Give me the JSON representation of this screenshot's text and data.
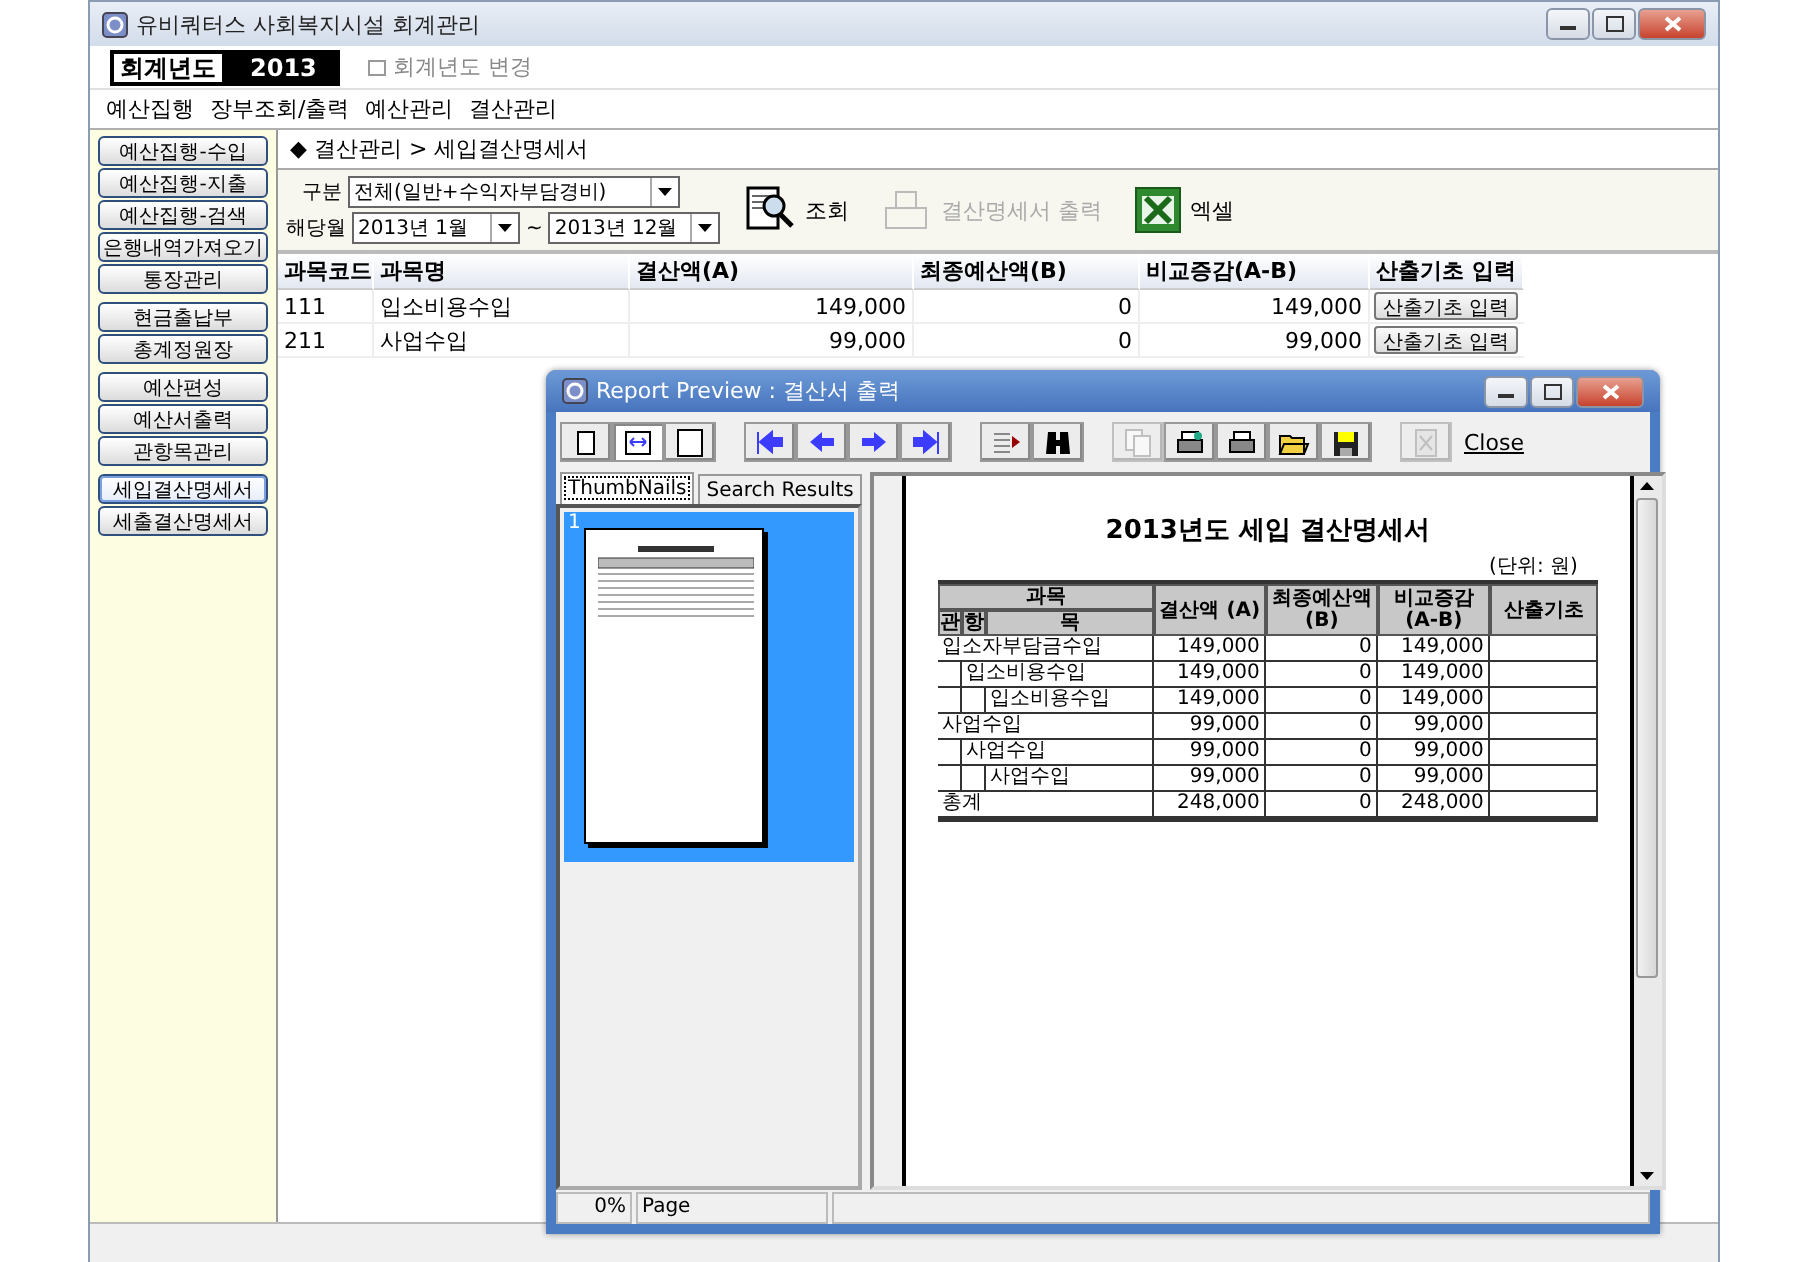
{
  "window": {
    "title": "유비쿼터스 사회복지시설 회계관리"
  },
  "year_bar": {
    "label": "회계년도",
    "year": "2013",
    "change_link": "회계년도 변경"
  },
  "menu": [
    "예산집행",
    "장부조회/출력",
    "예산관리",
    "결산관리"
  ],
  "sidebar": {
    "groups": [
      [
        {
          "label": "예산집행-수입",
          "selected": false
        },
        {
          "label": "예산집행-지출",
          "selected": false
        },
        {
          "label": "예산집행-검색",
          "selected": false
        },
        {
          "label": "은행내역가져오기",
          "selected": false
        },
        {
          "label": "통장관리",
          "selected": false
        }
      ],
      [
        {
          "label": "현금출납부",
          "selected": false
        },
        {
          "label": "총계정원장",
          "selected": false
        }
      ],
      [
        {
          "label": "예산편성",
          "selected": false
        },
        {
          "label": "예산서출력",
          "selected": false
        },
        {
          "label": "관항목관리",
          "selected": false
        }
      ],
      [
        {
          "label": "세입결산명세서",
          "selected": true
        },
        {
          "label": "세출결산명세서",
          "selected": false
        }
      ]
    ]
  },
  "breadcrumb": "◆ 결산관리 > 세입결산명세서",
  "filters": {
    "type_label": "구분",
    "type_value": "전체(일반+수익자부담경비)",
    "month_label": "해당월",
    "month_from": "2013년 1월",
    "range_sep": "~",
    "month_to": "2013년 12월"
  },
  "actions": [
    {
      "kind": "search",
      "label": "조회",
      "disabled": false
    },
    {
      "kind": "print",
      "label": "결산명세서 출력",
      "disabled": true
    },
    {
      "kind": "excel",
      "label": "엑셀",
      "disabled": false
    }
  ],
  "table": {
    "columns": [
      "과목코드",
      "과목명",
      "결산액(A)",
      "최종예산액(B)",
      "비교증감(A-B)",
      "산출기초 입력"
    ],
    "rows": [
      {
        "code": "111",
        "name": "입소비용수입",
        "settled": "149,000",
        "budget": "0",
        "diff": "149,000",
        "button": "산출기초 입력"
      },
      {
        "code": "211",
        "name": "사업수입",
        "settled": "99,000",
        "budget": "0",
        "diff": "99,000",
        "button": "산출기초 입력"
      }
    ]
  },
  "preview": {
    "title": "Report Preview : 결산서 출력",
    "toolbar": [
      [
        {
          "kind": "one-page",
          "selected": false,
          "disabled": false
        },
        {
          "kind": "fit-width",
          "selected": true,
          "disabled": false
        },
        {
          "kind": "full-page",
          "selected": false,
          "disabled": false
        }
      ],
      [
        {
          "kind": "first",
          "selected": false,
          "disabled": false
        },
        {
          "kind": "prev",
          "selected": false,
          "disabled": false
        },
        {
          "kind": "next",
          "selected": false,
          "disabled": false
        },
        {
          "kind": "last",
          "selected": false,
          "disabled": false
        }
      ],
      [
        {
          "kind": "goto",
          "selected": false,
          "disabled": false
        },
        {
          "kind": "find",
          "selected": false,
          "disabled": false
        }
      ],
      [
        {
          "kind": "copy",
          "selected": false,
          "disabled": true
        },
        {
          "kind": "print-setup",
          "selected": false,
          "disabled": false
        },
        {
          "kind": "print",
          "selected": false,
          "disabled": false
        },
        {
          "kind": "open",
          "selected": false,
          "disabled": false
        },
        {
          "kind": "save",
          "selected": false,
          "disabled": false
        }
      ],
      [
        {
          "kind": "close-page",
          "selected": false,
          "disabled": true
        }
      ]
    ],
    "close_label": "Close",
    "tabs": [
      {
        "label": "ThumbNails",
        "selected": true
      },
      {
        "label": "Search Results",
        "selected": false
      }
    ],
    "thumbnail_number": "1",
    "report": {
      "title": "2013년도 세입 결산명세서",
      "unit": "(단위: 원)",
      "header": {
        "subject": "과목",
        "levels": [
          "관",
          "항",
          "목"
        ],
        "settled": "결산액 (A)",
        "budget": "최종예산액 (B)",
        "diff": "비교증감 (A-B)",
        "basis": "산출기초"
      },
      "rows": [
        {
          "label": "입소자부담금수입",
          "settled": "149,000",
          "budget": "0",
          "diff": "149,000",
          "children": [
            {
              "label": "입소비용수입",
              "settled": "149,000",
              "budget": "0",
              "diff": "149,000",
              "children": [
                {
                  "label": "입소비용수입",
                  "settled": "149,000",
                  "budget": "0",
                  "diff": "149,000"
                }
              ]
            }
          ]
        },
        {
          "label": "사업수입",
          "settled": "99,000",
          "budget": "0",
          "diff": "99,000",
          "children": [
            {
              "label": "사업수입",
              "settled": "99,000",
              "budget": "0",
              "diff": "99,000",
              "children": [
                {
                  "label": "사업수입",
                  "settled": "99,000",
                  "budget": "0",
                  "diff": "99,000"
                }
              ]
            }
          ]
        },
        {
          "label": "총계",
          "settled": "248,000",
          "budget": "0",
          "diff": "248,000"
        }
      ]
    },
    "status": {
      "zoom": "0%",
      "page": "Page"
    }
  }
}
